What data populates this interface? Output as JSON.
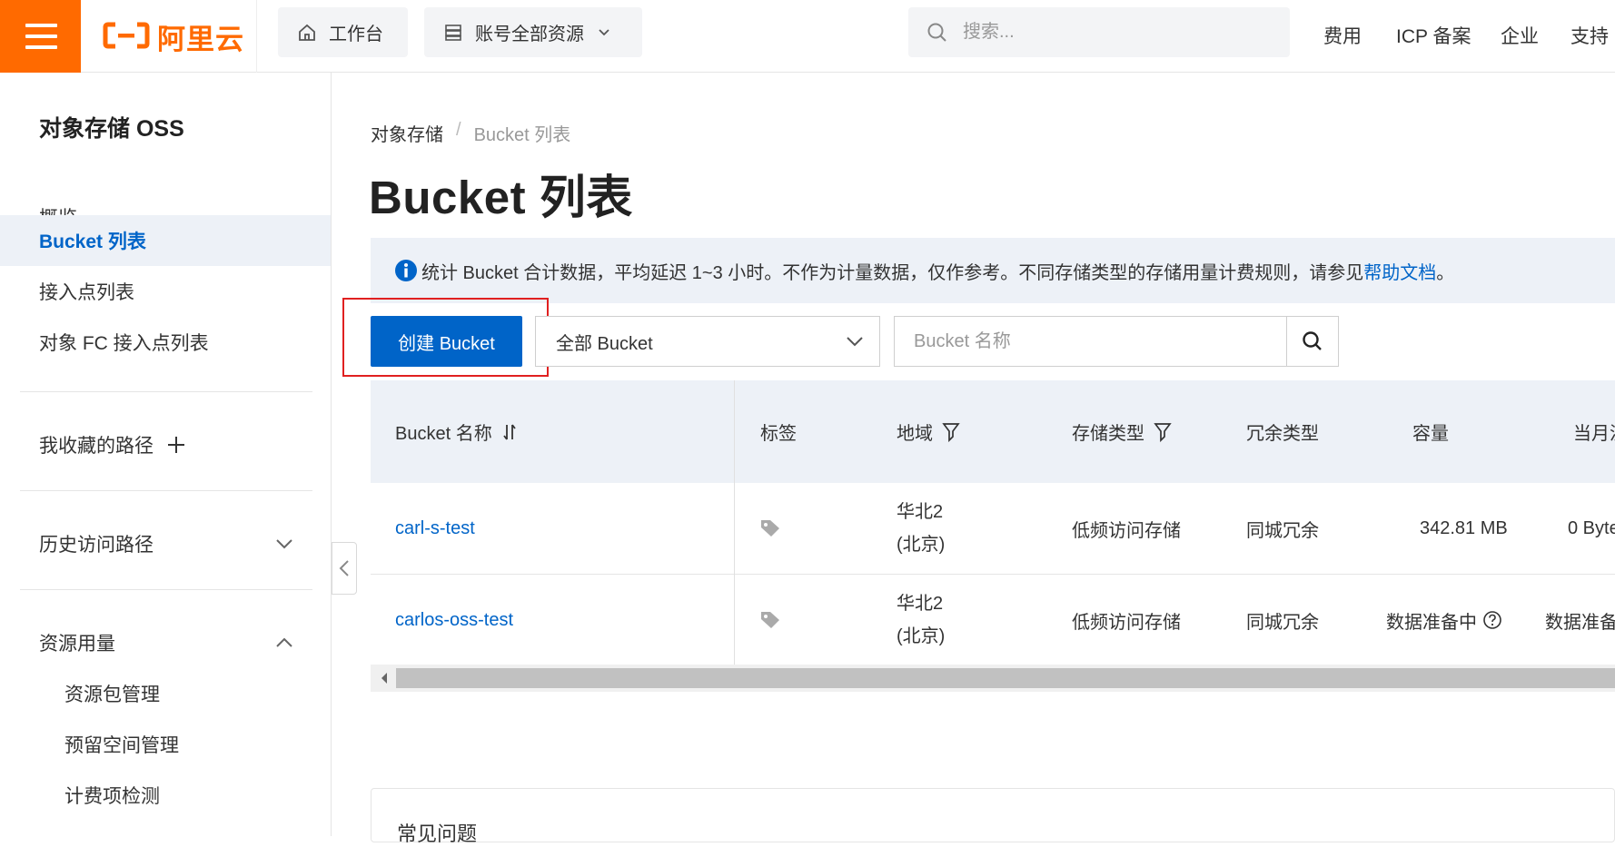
{
  "topbar": {
    "logo_text": "阿里云",
    "workbench_label": "工作台",
    "account_resources_label": "账号全部资源",
    "search_placeholder": "搜索...",
    "links": [
      "费用",
      "ICP 备案",
      "企业",
      "支持"
    ]
  },
  "sidebar": {
    "title": "对象存储 OSS",
    "items": [
      {
        "label": "概览",
        "active": false
      },
      {
        "label": "Bucket 列表",
        "active": true
      },
      {
        "label": "接入点列表",
        "active": false
      },
      {
        "label": "对象 FC 接入点列表",
        "active": false
      }
    ],
    "favorites_label": "我收藏的路径",
    "history_label": "历史访问路径",
    "resource_usage_label": "资源用量",
    "resource_sub_items": [
      "资源包管理",
      "预留空间管理",
      "计费项检测"
    ]
  },
  "breadcrumb": {
    "root": "对象存储",
    "separator": "/",
    "current": "Bucket 列表"
  },
  "page": {
    "title": "Bucket 列表"
  },
  "banner": {
    "text": "统计 Bucket 合计数据，平均延迟 1~3 小时。不作为计量数据，仅作参考。不同存储类型的存储用量计费规则，请参见",
    "link": "帮助文档",
    "end": "。"
  },
  "toolbar": {
    "create_label": "创建 Bucket",
    "filter_selected": "全部 Bucket",
    "search_placeholder": "Bucket 名称"
  },
  "table": {
    "headers": {
      "name": "Bucket 名称",
      "tags": "标签",
      "region": "地域",
      "storage_class": "存储类型",
      "redundancy": "冗余类型",
      "capacity": "容量",
      "monthly": "当月流"
    },
    "rows": [
      {
        "name": "carl-s-test",
        "region_line1": "华北2",
        "region_line2": "(北京)",
        "storage_class": "低频访问存储",
        "redundancy": "同城冗余",
        "capacity": "342.81 MB",
        "monthly": "0 Byte"
      },
      {
        "name": "carlos-oss-test",
        "region_line1": "华北2",
        "region_line2": "(北京)",
        "storage_class": "低频访问存储",
        "redundancy": "同城冗余",
        "capacity": "数据准备中",
        "monthly": "数据准备"
      }
    ]
  },
  "faq": {
    "title": "常见问题"
  },
  "colors": {
    "brand": "#ff6a00",
    "primary": "#0064c8",
    "highlight_box": "#e02020"
  }
}
